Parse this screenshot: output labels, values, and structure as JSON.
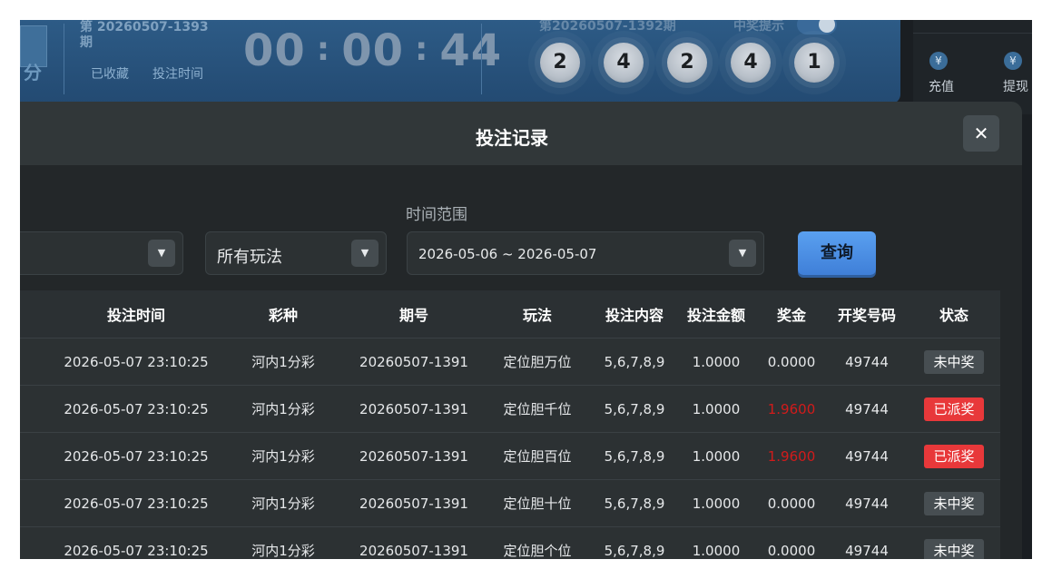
{
  "header": {
    "period_current": "第 20260507-1393期",
    "icon_char": "分",
    "favorite_link": "已收藏",
    "bet_time_link": "投注时间",
    "countdown": {
      "hh": "00",
      "mm": "00",
      "ss": "44"
    },
    "previous_period": "第20260507-1392期",
    "prize_hint_label": "中奖提示",
    "balls": [
      "2",
      "4",
      "2",
      "4",
      "1"
    ]
  },
  "side": {
    "deposit_label": "充值",
    "withdraw_label": "提现",
    "coin_glyph": "¥"
  },
  "modal": {
    "title": "投注记录",
    "close_glyph": "✕",
    "filters": {
      "time_range_label": "时间范围",
      "play_type_value": "所有玩法",
      "date_range_value": "2026-05-06 ~ 2026-05-07",
      "query_label": "查询"
    },
    "table": {
      "headers": [
        "投注时间",
        "彩种",
        "期号",
        "玩法",
        "投注内容",
        "投注金额",
        "奖金",
        "开奖号码",
        "状态"
      ],
      "rows": [
        {
          "time": "2026-05-07 23:10:25",
          "lottery": "河内1分彩",
          "period": "20260507-1391",
          "play": "定位胆万位",
          "content": "5,6,7,8,9",
          "amount": "1.0000",
          "prize": "0.0000",
          "draw": "49744",
          "status": "未中奖"
        },
        {
          "time": "2026-05-07 23:10:25",
          "lottery": "河内1分彩",
          "period": "20260507-1391",
          "play": "定位胆千位",
          "content": "5,6,7,8,9",
          "amount": "1.0000",
          "prize": "1.9600",
          "draw": "49744",
          "status": "已派奖"
        },
        {
          "time": "2026-05-07 23:10:25",
          "lottery": "河内1分彩",
          "period": "20260507-1391",
          "play": "定位胆百位",
          "content": "5,6,7,8,9",
          "amount": "1.0000",
          "prize": "1.9600",
          "draw": "49744",
          "status": "已派奖"
        },
        {
          "time": "2026-05-07 23:10:25",
          "lottery": "河内1分彩",
          "period": "20260507-1391",
          "play": "定位胆十位",
          "content": "5,6,7,8,9",
          "amount": "1.0000",
          "prize": "0.0000",
          "draw": "49744",
          "status": "未中奖"
        },
        {
          "time": "2026-05-07 23:10:25",
          "lottery": "河内1分彩",
          "period": "20260507-1391",
          "play": "定位胆个位",
          "content": "5,6,7,8,9",
          "amount": "1.0000",
          "prize": "0.0000",
          "draw": "49744",
          "status": "未中奖"
        }
      ]
    }
  },
  "colors": {
    "prize_paid_text": "#d11b1b",
    "badge_paid_bg": "#e8383a",
    "badge_unwon_bg": "#474e52",
    "query_button": "#4a8fe6"
  }
}
